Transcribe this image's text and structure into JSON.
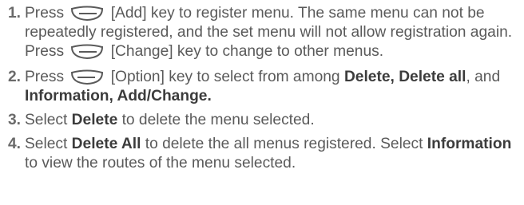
{
  "items": [
    {
      "number": "1.",
      "t1": "Press ",
      "t2": " [Add] key to register menu. The same menu can not be repeatedly registered, and the set menu will not allow registration again. Press ",
      "t3": " [Change] key to change to other menus."
    },
    {
      "number": "2.",
      "t1": "Press ",
      "t2": " [Option] key to select from among ",
      "b1": "Delete, Delete all",
      "t3": ", and ",
      "b2": "Information, Add/Change."
    },
    {
      "number": "3.",
      "t1": "Select ",
      "b1": "Delete",
      "t2": " to delete the menu selected."
    },
    {
      "number": "4.",
      "t1": "Select ",
      "b1": "Delete All",
      "t2": " to delete the all menus registered. Select ",
      "b2": "Information",
      "t3": " to view the routes of the menu selected."
    }
  ],
  "icons": {
    "right_soft_key": "right-soft-key-icon",
    "left_soft_key": "left-soft-key-icon"
  }
}
